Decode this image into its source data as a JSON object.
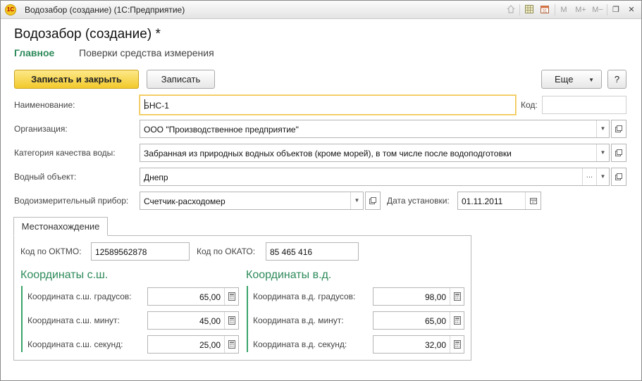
{
  "window": {
    "title": "Водозабор (создание)  (1С:Предприятие)",
    "logo_text": "1С"
  },
  "titlebar_icons": {
    "m": "M",
    "m_plus": "M+",
    "m_minus": "M−",
    "restore": "❐",
    "close": "✕"
  },
  "form": {
    "title": "Водозабор (создание) *",
    "nav_tabs": [
      {
        "label": "Главное",
        "active": true
      },
      {
        "label": "Поверки средства измерения",
        "active": false
      }
    ],
    "toolbar": {
      "save_close_label": "Записать и закрыть",
      "save_label": "Записать",
      "more_label": "Еще",
      "help_label": "?"
    },
    "fields": {
      "name": {
        "label": "Наименование:",
        "value": "БНС-1"
      },
      "code": {
        "label": "Код:",
        "value": ""
      },
      "organization": {
        "label": "Организация:",
        "value": "ООО \"Производственное предприятие\""
      },
      "water_quality": {
        "label": "Категория качества воды:",
        "value": "Забранная из природных водных объектов (кроме морей), в том числе после водоподготовки"
      },
      "water_body": {
        "label": "Водный объект:",
        "value": "Днепр"
      },
      "meter": {
        "label": "Водоизмерительный прибор:",
        "value": "Счетчик-расходомер"
      },
      "install_date": {
        "label": "Дата установки:",
        "value": "01.11.2011"
      }
    },
    "location_tab": {
      "label": "Местонахождение",
      "oktmo": {
        "label": "Код по ОКТМО:",
        "value": "12589562878"
      },
      "okato": {
        "label": "Код по ОКАТО:",
        "value": "85 465 416"
      },
      "north": {
        "title": "Координаты с.ш.",
        "rows": [
          {
            "label": "Координата с.ш. градусов:",
            "value": "65,00"
          },
          {
            "label": "Координата с.ш. минут:",
            "value": "45,00"
          },
          {
            "label": "Координата с.ш. секунд:",
            "value": "25,00"
          }
        ]
      },
      "east": {
        "title": "Координаты в.д.",
        "rows": [
          {
            "label": "Координата в.д. градусов:",
            "value": "98,00"
          },
          {
            "label": "Координата в.д. минут:",
            "value": "65,00"
          },
          {
            "label": "Координата в.д. секунд:",
            "value": "32,00"
          }
        ]
      }
    }
  },
  "colors": {
    "accent_green": "#2d8a5a",
    "primary_button": "#f2c92c",
    "focus_border": "#f0c24a"
  }
}
